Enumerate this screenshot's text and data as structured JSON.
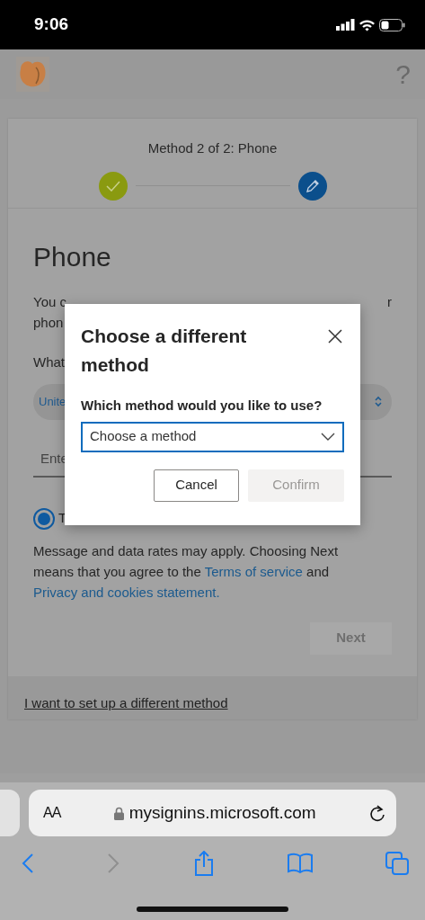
{
  "status_bar": {
    "time": "9:06"
  },
  "header": {
    "help": "?"
  },
  "stepper": {
    "title": "Method 2 of 2: Phone",
    "steps": [
      {
        "kind": "done"
      },
      {
        "kind": "current"
      }
    ]
  },
  "form": {
    "heading": "Phone",
    "intro_line_1_start": "You c",
    "intro_line_1_end": "r",
    "intro_line_2_start": "phon",
    "question": "What",
    "country_select": {
      "value": "Unite"
    },
    "phone_field": {
      "placeholder": "Ente"
    },
    "option": {
      "label": "T",
      "selected": true
    },
    "notice": {
      "text": "Message and data rates may apply. Choosing Next means that you agree to the ",
      "link_1": "Terms of service",
      "between": " and ",
      "link_2": "Privacy and cookies statement."
    },
    "next_button": {
      "label": "Next",
      "disabled": true
    }
  },
  "footer_link": "I want to set up a different method",
  "modal": {
    "title": "Choose a different method",
    "label": "Which method would you like to use?",
    "select": {
      "placeholder": "Choose a method"
    },
    "buttons": [
      {
        "label": "Cancel",
        "disabled": false
      },
      {
        "label": "Confirm",
        "disabled": true
      }
    ]
  },
  "browser": {
    "text_size": "AA",
    "url": "mysignins.microsoft.com",
    "back_disabled": false,
    "forward_disabled": true
  }
}
